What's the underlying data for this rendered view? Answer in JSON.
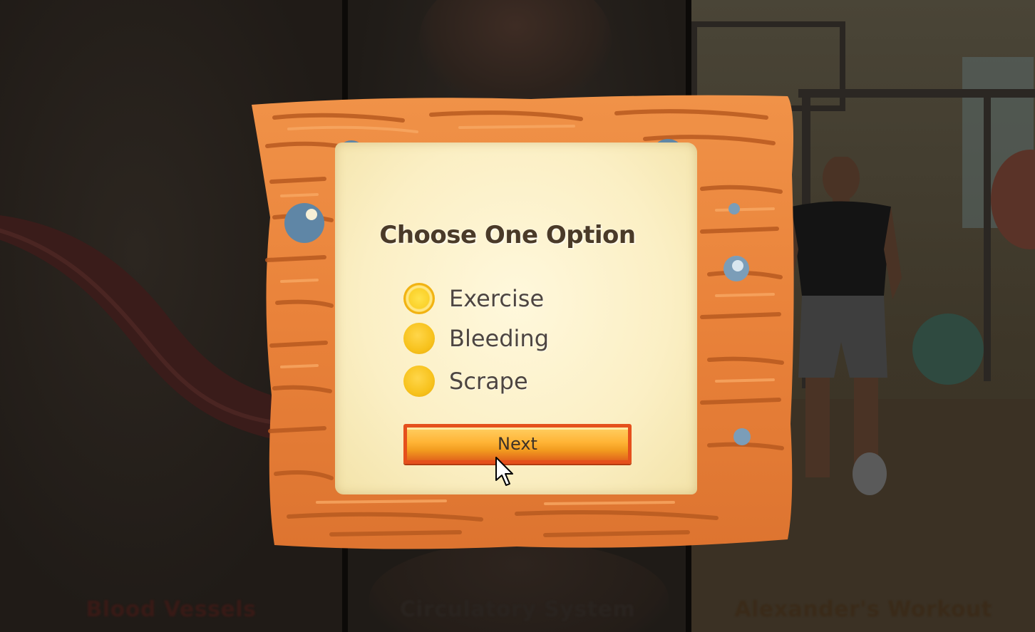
{
  "background_panels": [
    {
      "caption": "Blood Vessels"
    },
    {
      "caption": "Circulatory System"
    },
    {
      "caption": "Alexander's Workout"
    }
  ],
  "dialog": {
    "title": "Choose One Option",
    "options": [
      {
        "label": "Exercise",
        "selected": true
      },
      {
        "label": "Bleeding",
        "selected": false
      },
      {
        "label": "Scrape",
        "selected": false
      }
    ],
    "next_label": "Next"
  },
  "colors": {
    "wood": "#e9823a",
    "wood_dark": "#b85a20",
    "parchment": "#fbefc4",
    "radio": "#f7c21c",
    "button": "#ffb436",
    "button_border": "#e5501c",
    "title_text": "#4a3a28"
  },
  "icons": {
    "cursor": "mouse-pointer-icon",
    "nails": "nail-icon"
  }
}
